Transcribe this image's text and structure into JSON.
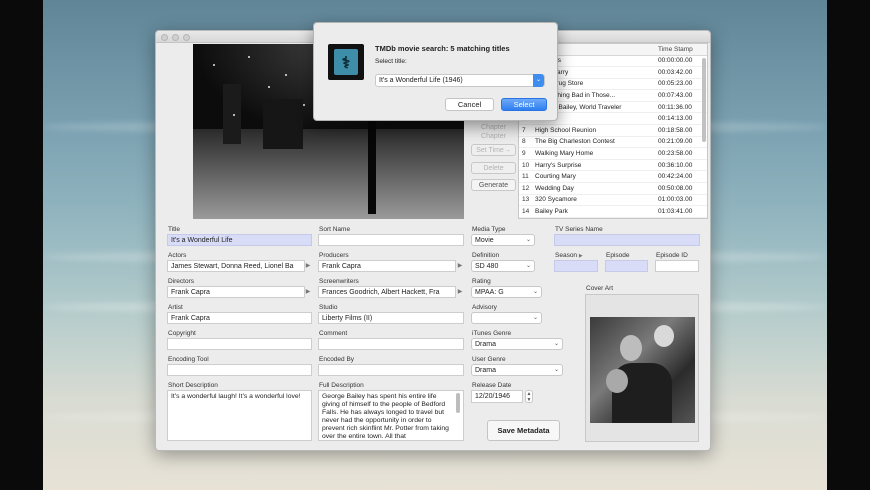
{
  "dialog": {
    "title": "TMDb movie search: 5 matching titles",
    "select_label": "Select title:",
    "selected_title": "It's a Wonderful Life (1946)",
    "cancel_label": "Cancel",
    "select_button_label": "Select"
  },
  "video_buttons": {
    "chapter_top": "Chapter",
    "chapter_upper": "Chapter",
    "set_time": "Set Time",
    "delete": "Delete",
    "generate": "Generate"
  },
  "chapters": {
    "col_title": "Title",
    "col_time": "Time Stamp",
    "rows": [
      {
        "num": "",
        "title": "g Credits",
        "time": "00:00:00.00"
      },
      {
        "num": "",
        "title": "aving Harry",
        "time": "00:03:42.00"
      },
      {
        "num": "",
        "title": "wer's Drug Store",
        "time": "00:05:23.00"
      },
      {
        "num": "",
        "title": "t Something Bad in Those...",
        "time": "00:07:43.00"
      },
      {
        "num": "",
        "title": "George Bailey, World Traveler",
        "time": "00:11:36.00"
      },
      {
        "num": "",
        "title": "al",
        "time": "00:14:13.00"
      },
      {
        "num": "7",
        "title": "High School Reunion",
        "time": "00:18:58.00"
      },
      {
        "num": "8",
        "title": "The Big Charleston Contest",
        "time": "00:21:09.00"
      },
      {
        "num": "9",
        "title": "Walking Mary Home",
        "time": "00:23:58.00"
      },
      {
        "num": "10",
        "title": "Harry's Surprise",
        "time": "00:36:10.00"
      },
      {
        "num": "11",
        "title": "Courting Mary",
        "time": "00:42:24.00"
      },
      {
        "num": "12",
        "title": "Wedding Day",
        "time": "00:50:08.00"
      },
      {
        "num": "13",
        "title": "320 Sycamore",
        "time": "01:00:03.00"
      },
      {
        "num": "14",
        "title": "Bailey Park",
        "time": "01:03:41.00"
      }
    ]
  },
  "form": {
    "title_label": "Title",
    "title_value": "It's a Wonderful Life",
    "sort_name_label": "Sort Name",
    "sort_name_value": "",
    "media_type_label": "Media Type",
    "media_type_value": "Movie",
    "tv_series_label": "TV Series Name",
    "tv_series_value": "",
    "actors_label": "Actors",
    "actors_value": "James Stewart, Donna Reed, Lionel Ba",
    "producers_label": "Producers",
    "producers_value": "Frank Capra",
    "definition_label": "Definition",
    "definition_value": "SD 480",
    "season_label": "Season",
    "episode_label": "Episode",
    "episode_id_label": "Episode ID",
    "directors_label": "Directors",
    "directors_value": "Frank Capra",
    "screenwriters_label": "Screenwriters",
    "screenwriters_value": "Frances Goodrich, Albert Hackett, Fra",
    "rating_label": "Rating",
    "rating_value": "MPAA: G",
    "cover_art_label": "Cover Art",
    "artist_label": "Artist",
    "artist_value": "Frank Capra",
    "studio_label": "Studio",
    "studio_value": "Liberty Films (II)",
    "advisory_label": "Advisory",
    "advisory_value": "",
    "copyright_label": "Copyright",
    "copyright_value": "",
    "comment_label": "Comment",
    "comment_value": "",
    "itunes_genre_label": "iTunes Genre",
    "itunes_genre_value": "Drama",
    "encoding_tool_label": "Encoding Tool",
    "encoding_tool_value": "",
    "encoded_by_label": "Encoded By",
    "encoded_by_value": "",
    "user_genre_label": "User Genre",
    "user_genre_value": "Drama",
    "short_desc_label": "Short Description",
    "short_desc_value": "It's a wonderful laugh! It's a wonderful love!",
    "full_desc_label": "Full Description",
    "full_desc_value": "George Bailey has spent his entire life giving of himself to the people of Bedford Falls. He has always longed to travel but never had the opportunity in order to prevent rich skinflint Mr. Potter from taking over the entire town. All that",
    "release_date_label": "Release Date",
    "release_date_value": "12/20/1946",
    "save_label": "Save Metadata"
  }
}
